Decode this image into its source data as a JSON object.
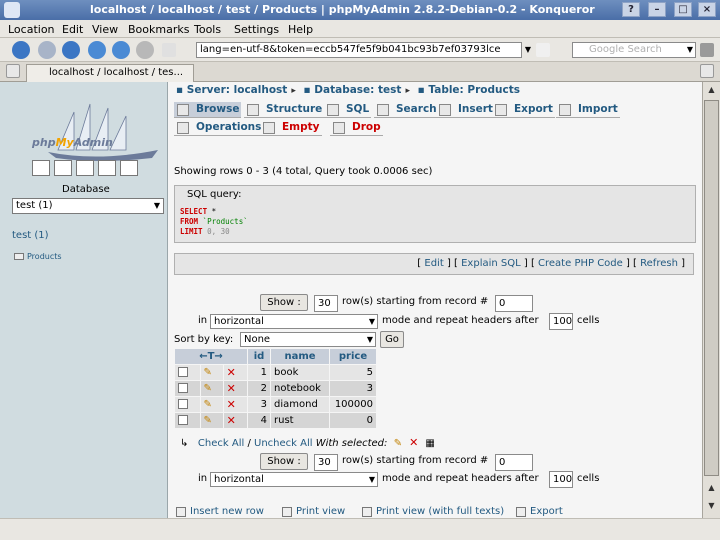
{
  "window": {
    "title": "localhost / localhost / test / Products | phpMyAdmin 2.8.2-Debian-0.2 - Konqueror",
    "help_btn": "?",
    "minimize_btn": "–",
    "maximize_btn": "□",
    "close_btn": "×"
  },
  "menubar": [
    "Location",
    "Edit",
    "View",
    "Bookmarks",
    "Tools",
    "Settings",
    "Help"
  ],
  "toolbar": {
    "address": "lang=en-utf-8&token=eccb547fe5f9b041bc93b7ef03793lce",
    "search_placeholder": "Google Search"
  },
  "browser_tab": {
    "label": "localhost / localhost / tes..."
  },
  "sidebar": {
    "logo_php": "php",
    "logo_my": "My",
    "logo_admin": "Admin",
    "database_label": "Database",
    "db_select_value": "test (1)",
    "db_link": "test (1)",
    "table_link": "Products"
  },
  "breadcrumb": {
    "server": "Server: localhost",
    "database": "Database: test",
    "table": "Table: Products"
  },
  "tabs": [
    {
      "label": "Browse"
    },
    {
      "label": "Structure"
    },
    {
      "label": "SQL"
    },
    {
      "label": "Search"
    },
    {
      "label": "Insert"
    },
    {
      "label": "Export"
    },
    {
      "label": "Import"
    },
    {
      "label": "Operations"
    },
    {
      "label": "Empty"
    },
    {
      "label": "Drop"
    }
  ],
  "info_text": "Showing rows 0 - 3 (4 total, Query took 0.0006 sec)",
  "sql": {
    "legend": "SQL query:",
    "kw_select": "SELECT",
    "select_rest": " *",
    "kw_from": "FROM",
    "table": " `Products`",
    "kw_limit": "LIMIT",
    "limit_rest": " 0, 30"
  },
  "actions": {
    "edit": "Edit",
    "explain": "Explain SQL",
    "php": "Create PHP Code",
    "refresh": "Refresh"
  },
  "nav_top": {
    "show_btn": "Show :",
    "rows_value": "30",
    "rows_label": "row(s) starting from record #",
    "start_value": "0",
    "in_label": "in",
    "mode_value": "horizontal",
    "mode_label": "mode and repeat headers after",
    "headers_value": "100",
    "cells_label": "cells"
  },
  "sort": {
    "label": "Sort by key:",
    "value": "None",
    "go_btn": "Go"
  },
  "table": {
    "arrows_header": "←T→",
    "columns": [
      "id",
      "name",
      "price"
    ],
    "rows": [
      {
        "id": "1",
        "name": "book",
        "price": "5"
      },
      {
        "id": "2",
        "name": "notebook",
        "price": "3"
      },
      {
        "id": "3",
        "name": "diamond",
        "price": "100000"
      },
      {
        "id": "4",
        "name": "rust",
        "price": "0"
      }
    ]
  },
  "with_selected": {
    "check_all": "Check All",
    "sep": " / ",
    "uncheck_all": "Uncheck All",
    "label": "With selected:"
  },
  "nav_bottom": {
    "show_btn": "Show :",
    "rows_value": "30",
    "rows_label": "row(s) starting from record #",
    "start_value": "0",
    "in_label": "in",
    "mode_value": "horizontal",
    "mode_label": "mode and repeat headers after",
    "headers_value": "100",
    "cells_label": "cells"
  },
  "bottom_links": {
    "insert": "Insert new row",
    "print": "Print view",
    "print_full": "Print view (with full texts)",
    "export": "Export"
  },
  "colors": {
    "link": "#235a81",
    "header_bg": "#c7ced9",
    "sidebar_bg": "#d0dce0",
    "danger": "#cc0000"
  }
}
